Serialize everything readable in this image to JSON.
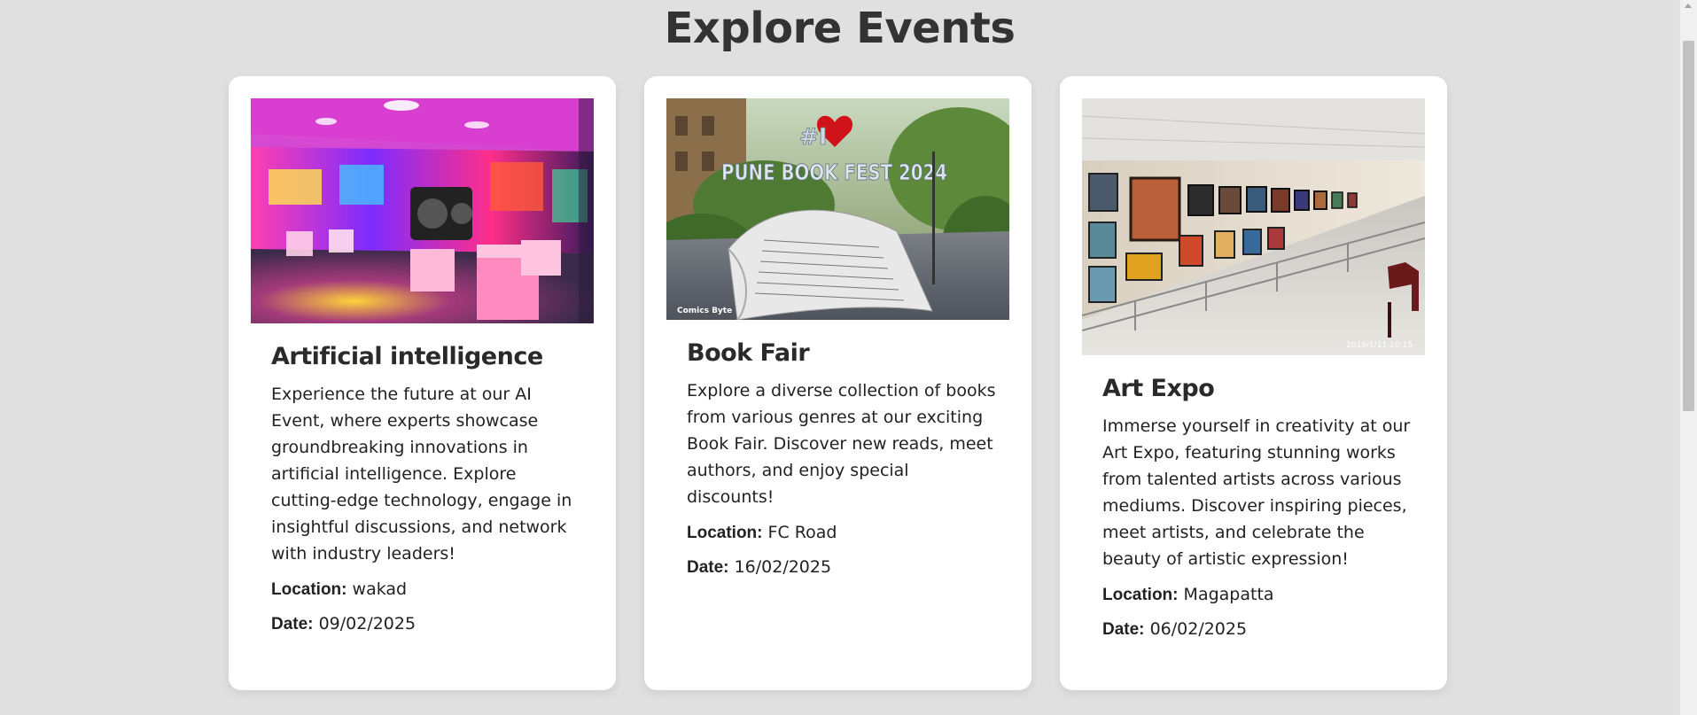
{
  "page": {
    "heading": "Explore Events"
  },
  "events": [
    {
      "title": "Artificial intelligence",
      "description": "Experience the future at our AI Event, where experts showcase groundbreaking innovations in artificial intelligence. Explore cutting-edge technology, engage in insightful discussions, and network with industry leaders!",
      "location_label": "Location:",
      "location": "wakad",
      "date_label": "Date:",
      "date": "09/02/2025",
      "image": "ai-event-neon-room-photo"
    },
    {
      "title": "Book Fair",
      "description": "Explore a diverse collection of books from various genres at our exciting Book Fair. Discover new reads, meet authors, and enjoy special discounts!",
      "location_label": "Location:",
      "location": "FC Road",
      "date_label": "Date:",
      "date": "16/02/2025",
      "image": "pune-book-fest-photo",
      "image_text": {
        "sign_top": "#I",
        "sign_main": "PUNE BOOK FEST 2024",
        "credit": "Comics Byte"
      }
    },
    {
      "title": "Art Expo",
      "description": "Immerse yourself in creativity at our Art Expo, featuring stunning works from talented artists across various mediums. Discover inspiring pieces, meet artists, and celebrate the beauty of artistic expression!",
      "location_label": "Location:",
      "location": "Magapatta",
      "date_label": "Date:",
      "date": "06/02/2025",
      "image": "art-gallery-hall-photo",
      "image_text": {
        "timestamp": "2019/1/11  10:15"
      }
    }
  ]
}
